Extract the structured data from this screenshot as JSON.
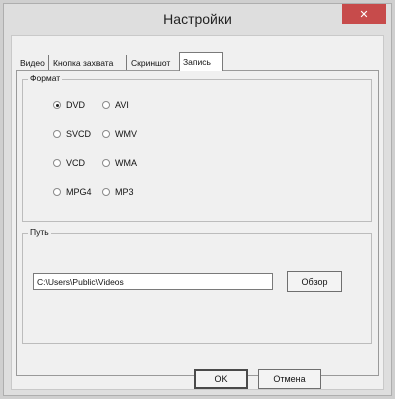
{
  "window": {
    "title": "Настройки"
  },
  "tabs": [
    "Видео",
    "Кнопка захвата",
    "Скриншот",
    "Запись"
  ],
  "active_tab": "Запись",
  "format_group": {
    "label": "Формат",
    "options": [
      {
        "label": "DVD",
        "selected": true
      },
      {
        "label": "AVI",
        "selected": false
      },
      {
        "label": "SVCD",
        "selected": false
      },
      {
        "label": "WMV",
        "selected": false
      },
      {
        "label": "VCD",
        "selected": false
      },
      {
        "label": "WMA",
        "selected": false
      },
      {
        "label": "MPG4",
        "selected": false
      },
      {
        "label": "MP3",
        "selected": false
      }
    ]
  },
  "path_group": {
    "label": "Путь",
    "value": "C:\\Users\\Public\\Videos",
    "browse_label": "Обзор"
  },
  "buttons": {
    "ok": "OK",
    "cancel": "Отмена"
  },
  "colors": {
    "close_button": "#c74b4b"
  },
  "icons": {
    "close": "close-icon"
  }
}
